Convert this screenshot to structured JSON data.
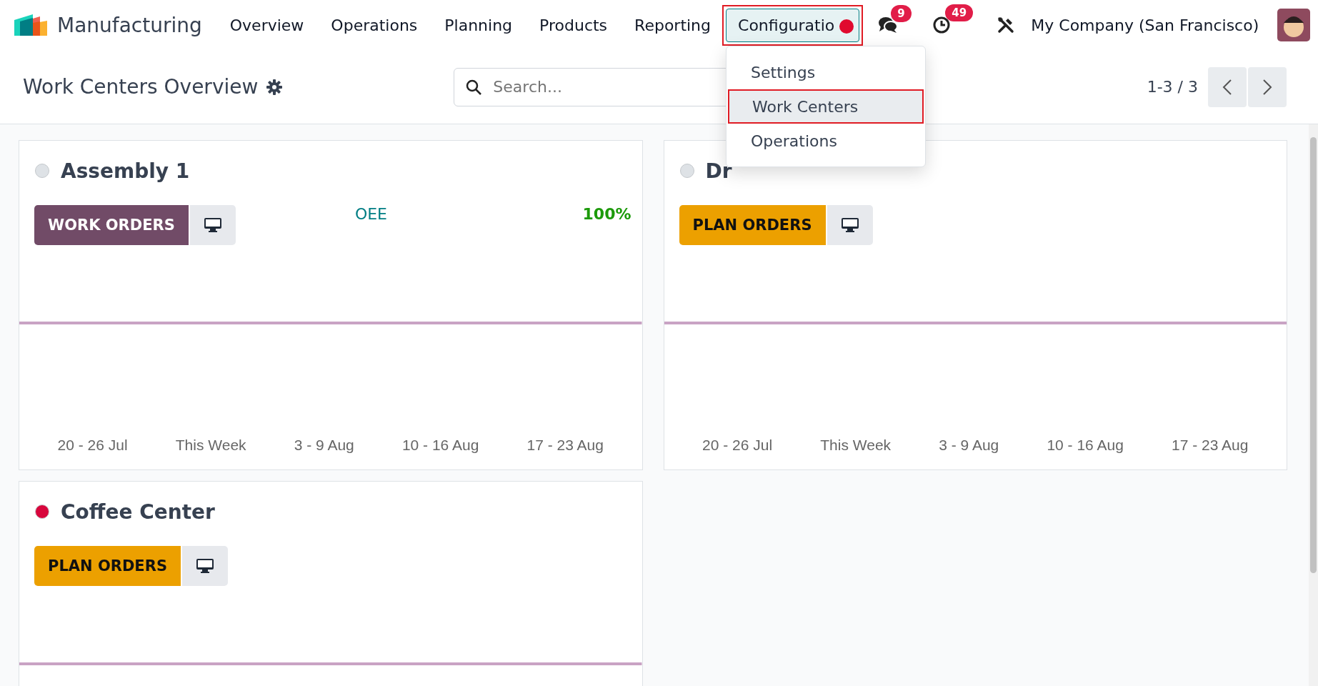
{
  "navbar": {
    "app_name": "Manufacturing",
    "menus": [
      {
        "label": "Overview",
        "selected": false,
        "highlighted": false
      },
      {
        "label": "Operations",
        "selected": false,
        "highlighted": false
      },
      {
        "label": "Planning",
        "selected": false,
        "highlighted": false
      },
      {
        "label": "Products",
        "selected": false,
        "highlighted": false
      },
      {
        "label": "Reporting",
        "selected": false,
        "highlighted": false
      },
      {
        "label": "Configuratio",
        "selected": true,
        "highlighted": true
      }
    ],
    "messages_badge": "9",
    "activities_badge": "49",
    "company": "My Company (San Francisco)"
  },
  "dropdown": {
    "items": [
      {
        "label": "Settings",
        "selected": false,
        "highlighted": false
      },
      {
        "label": "Work Centers",
        "selected": true,
        "highlighted": true
      },
      {
        "label": "Operations",
        "selected": false,
        "highlighted": false
      }
    ]
  },
  "control_panel": {
    "title": "Work Centers Overview",
    "search": {
      "placeholder": "Search..."
    },
    "pager": "1-3 / 3"
  },
  "cards": [
    {
      "name": "Assembly 1",
      "color": "#dee2e6",
      "button": {
        "kind": "work",
        "label": "WORK ORDERS"
      },
      "oee_label": "OEE",
      "oee_value": "100%",
      "weeks": [
        "20 - 26 Jul",
        "This Week",
        "3 - 9 Aug",
        "10 - 16 Aug",
        "17 - 23 Aug"
      ]
    },
    {
      "name": "Dr",
      "color": "#dee2e6",
      "button": {
        "kind": "plan",
        "label": "PLAN ORDERS"
      },
      "weeks": [
        "20 - 26 Jul",
        "This Week",
        "3 - 9 Aug",
        "10 - 16 Aug",
        "17 - 23 Aug"
      ]
    },
    {
      "name": "Coffee Center",
      "color": "#d8063c",
      "button": {
        "kind": "plan",
        "label": "PLAN ORDERS"
      }
    }
  ]
}
